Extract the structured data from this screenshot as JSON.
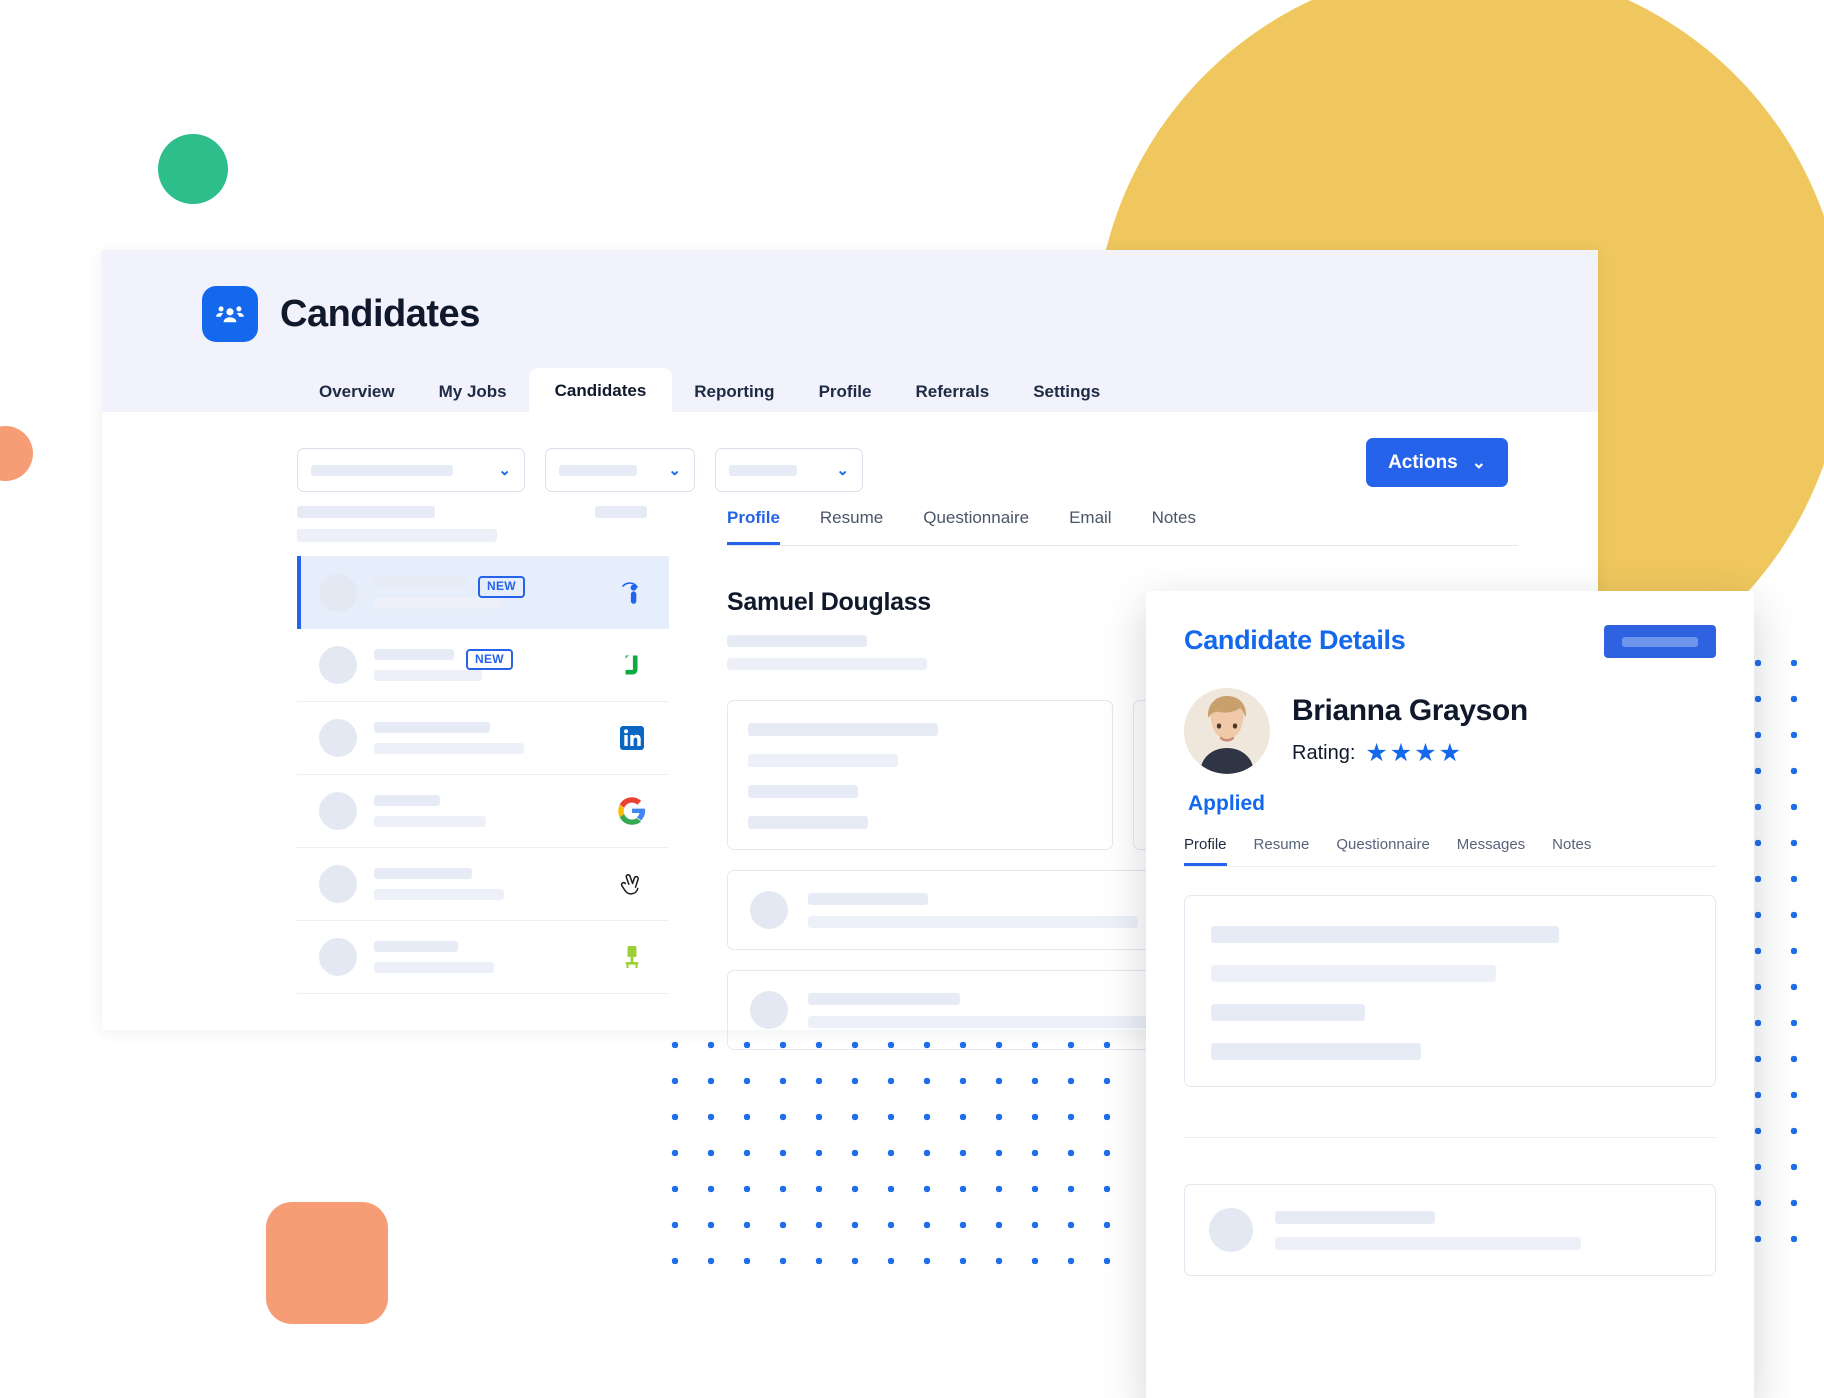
{
  "app": {
    "title": "Candidates",
    "brand_icon": "people-group-icon",
    "tabs": [
      {
        "label": "Overview",
        "active": false
      },
      {
        "label": "My Jobs",
        "active": false
      },
      {
        "label": "Candidates",
        "active": true
      },
      {
        "label": "Reporting",
        "active": false
      },
      {
        "label": "Profile",
        "active": false
      },
      {
        "label": "Referrals",
        "active": false
      },
      {
        "label": "Settings",
        "active": false
      }
    ]
  },
  "toolbar": {
    "filters": [
      {
        "name": "filter-1",
        "value": ""
      },
      {
        "name": "filter-2",
        "value": ""
      },
      {
        "name": "filter-3",
        "value": ""
      }
    ],
    "actions_label": "Actions",
    "chevron": "⌄"
  },
  "candidate_list": {
    "rows": [
      {
        "badge": "NEW",
        "source": "indeed-icon",
        "selected": true
      },
      {
        "badge": "NEW",
        "source": "glassdoor-icon",
        "selected": false
      },
      {
        "badge": "",
        "source": "linkedin-icon",
        "selected": false
      },
      {
        "badge": "",
        "source": "google-icon",
        "selected": false
      },
      {
        "badge": "",
        "source": "angellist-icon",
        "selected": false
      },
      {
        "badge": "",
        "source": "ziprecruiter-icon",
        "selected": false
      }
    ]
  },
  "detail": {
    "tabs": [
      {
        "label": "Profile",
        "active": true
      },
      {
        "label": "Resume",
        "active": false
      },
      {
        "label": "Questionnaire",
        "active": false
      },
      {
        "label": "Email",
        "active": false
      },
      {
        "label": "Notes",
        "active": false
      }
    ],
    "candidate_name": "Samuel Douglass"
  },
  "details_panel": {
    "title": "Candidate Details",
    "action_button": "",
    "candidate_name": "Brianna Grayson",
    "rating_label": "Rating:",
    "rating_value": 4,
    "rating_max": 4,
    "star_glyph": "★",
    "status": "Applied",
    "tabs": [
      {
        "label": "Profile",
        "active": true
      },
      {
        "label": "Resume",
        "active": false
      },
      {
        "label": "Questionnaire",
        "active": false
      },
      {
        "label": "Messages",
        "active": false
      },
      {
        "label": "Notes",
        "active": false
      }
    ]
  },
  "colors": {
    "primary_blue": "#1368EE",
    "button_blue": "#2563EB",
    "yellow": "#EFC75E",
    "green": "#2DBE8B",
    "orange": "#F79D76",
    "header_bg": "#F1F2FB",
    "skeleton": "#E7EBF5"
  }
}
